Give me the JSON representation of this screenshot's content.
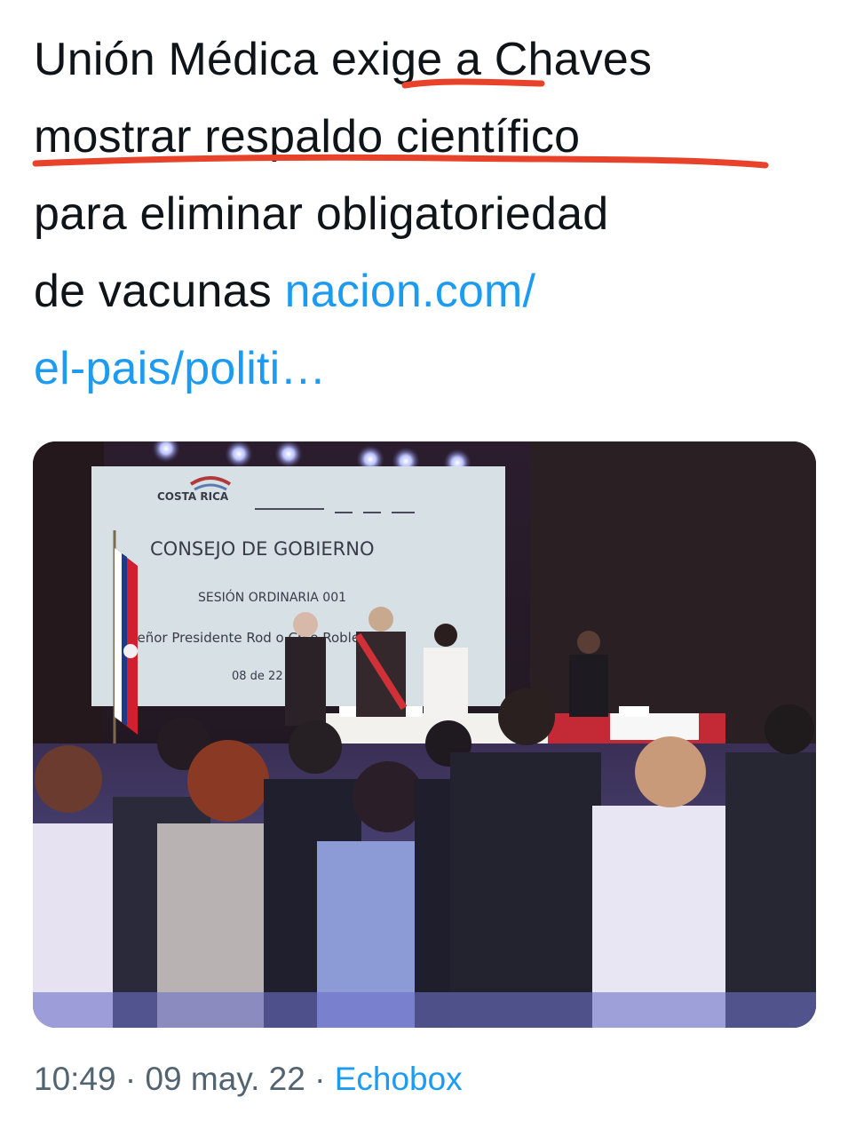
{
  "tweet": {
    "lines": [
      {
        "before": "Unión Médica ",
        "highlight": "exige",
        "after": " a Chaves"
      },
      {
        "text": "mostrar respaldo científico"
      },
      {
        "text": "para eliminar obligatoriedad"
      },
      {
        "text": "de vacunas ",
        "link": "nacion.com/"
      },
      {
        "link": "el-pais/politi…"
      }
    ],
    "underline_color": "#e8432a"
  },
  "media": {
    "logo_text": "COSTA RICA",
    "screen_title": "CONSEJO DE GOBIERNO",
    "screen_subtitle": "SESIÓN ORDINARIA 001",
    "screen_line": "Señor Presidente Rod   o Ch   e Roble",
    "screen_date": "08 de                 22"
  },
  "footer": {
    "time": "10:49",
    "sep1": " · ",
    "date": "09 may. 22",
    "sep2": " · ",
    "source": "Echobox"
  },
  "colors": {
    "link": "#1d9bf0",
    "meta": "#536471",
    "text": "#0f1419"
  }
}
